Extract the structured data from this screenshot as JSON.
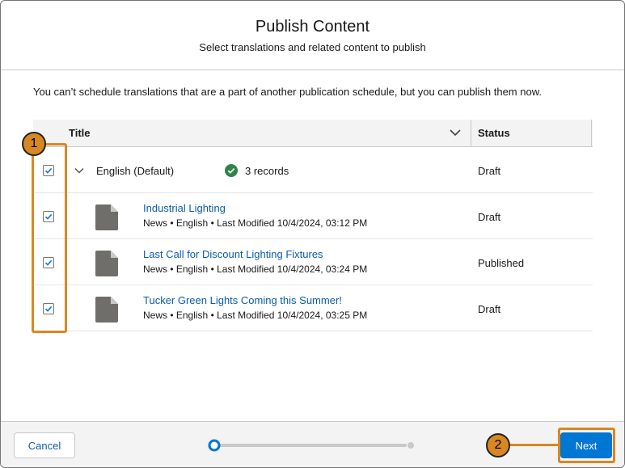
{
  "modal": {
    "title": "Publish Content",
    "subtitle": "Select translations and related content to publish"
  },
  "notice": "You can’t schedule translations that are a part of another publication schedule, but you can publish them now.",
  "table": {
    "col_title": "Title",
    "col_status": "Status",
    "group": {
      "label": "English (Default)",
      "count_label": "3 records",
      "status": "Draft",
      "checked": true
    },
    "items": [
      {
        "title": "Industrial Lighting",
        "meta": "News • English • Last Modified 10/4/2024, 03:12 PM",
        "status": "Draft",
        "checked": true
      },
      {
        "title": "Last Call for Discount Lighting Fixtures",
        "meta": "News • English • Last Modified 10/4/2024, 03:24 PM",
        "status": "Published",
        "checked": true
      },
      {
        "title": "Tucker Green Lights Coming this Summer!",
        "meta": "News • English • Last Modified 10/4/2024, 03:25 PM",
        "status": "Draft",
        "checked": true
      }
    ]
  },
  "footer": {
    "cancel_label": "Cancel",
    "next_label": "Next",
    "progress_step": 1,
    "progress_total": 2
  },
  "callouts": {
    "one": "1",
    "two": "2"
  },
  "colors": {
    "brand": "#0176d3",
    "link": "#0b5cab",
    "callout": "#d88822",
    "success": "#2e844a"
  },
  "icons": [
    "chevron-down-icon",
    "check-circle-icon",
    "document-icon",
    "checkbox-check-icon"
  ]
}
